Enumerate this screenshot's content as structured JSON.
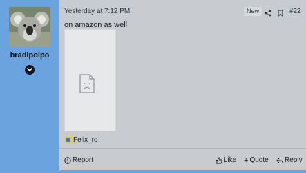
{
  "user": {
    "username": "bradipolpo",
    "avatar_icon": "koala-avatar",
    "expand_icon": "chevron-down-icon"
  },
  "post": {
    "time": "Yesterday at 7:12 PM",
    "badge": "New",
    "post_number": "#22",
    "body": "on amazon as well",
    "media_icon": "broken-image-icon",
    "reaction": {
      "icon": "like-emoji",
      "user": "Felix_ro"
    }
  },
  "footer": {
    "report_label": "Report",
    "like_label": "Like",
    "quote_label": "Quote",
    "reply_label": "Reply"
  },
  "colors": {
    "sidebar": "#6aa3dd",
    "post_bg": "#c8ccd0",
    "badge_bg": "#d7dadd",
    "text": "#1b1f24"
  }
}
